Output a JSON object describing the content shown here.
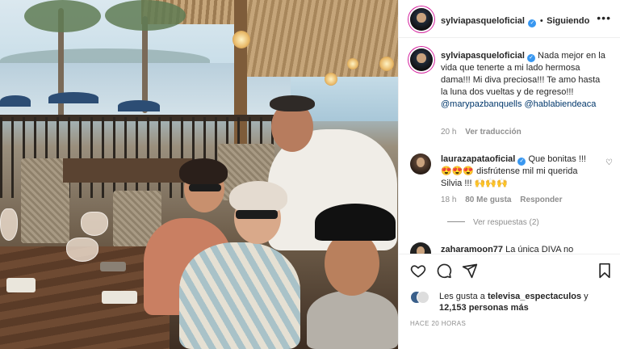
{
  "post": {
    "author": "sylviapasqueloficial",
    "follow_state": "Siguiendo",
    "separator": "•",
    "more_icon": "more-horizontal-icon"
  },
  "caption": {
    "username": "sylviapasqueloficial",
    "text": " Nada mejor en la vida que tenerte a mi lado hermosa dama!!! Mi diva preciosa!!! Te amo hasta la luna dos vueltas y de regreso!!! ",
    "mention1": "@marypazbanquells",
    "mention2": "@hablabiendeaca",
    "age": "20 h",
    "translate": "Ver traducción"
  },
  "comments": [
    {
      "username": "laurazapataoficial",
      "text": " Que bonitas !!! 😍😍😍 disfrútense mil mi querida Silvia !!! 🙌🙌🙌",
      "age": "18 h",
      "likes": "80 Me gusta",
      "reply": "Responder",
      "view_replies": "Ver respuestas (2)"
    },
    {
      "username": "zaharamoon77",
      "text": " La única DIVA no"
    }
  ],
  "likes": {
    "prefix": "Les gusta a ",
    "user": "televisa_espectaculos",
    "middle": " y",
    "count": "12,153 personas más"
  },
  "timestamp": "HACE 20 HORAS",
  "colors": {
    "verified": "#3897f0",
    "mention": "#00376b",
    "muted": "#8e8e8e",
    "text": "#262626"
  }
}
